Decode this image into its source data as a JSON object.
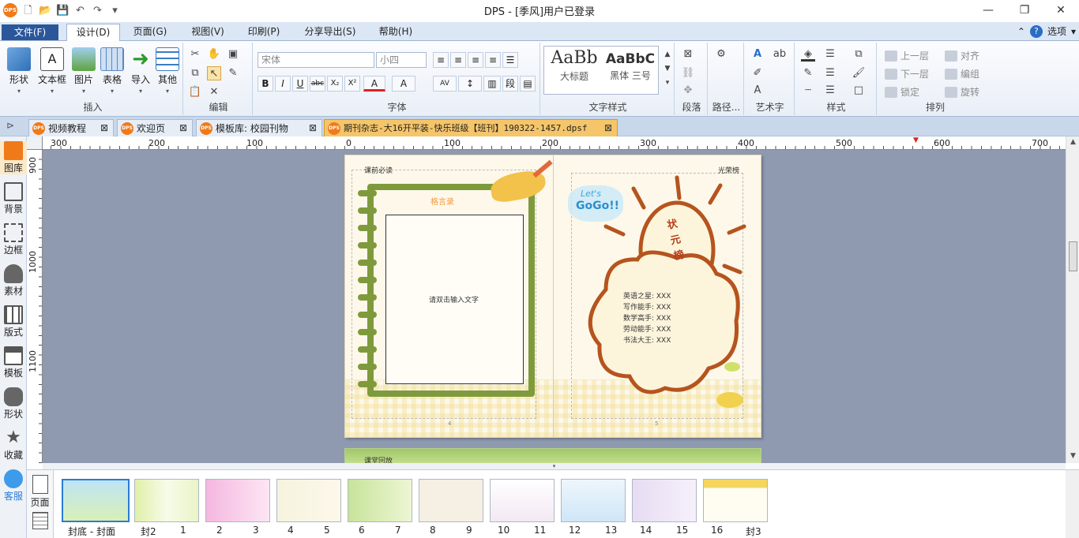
{
  "window": {
    "title": "DPS - [季风]用户已登录",
    "min": "—",
    "max": "❐",
    "close": "✕"
  },
  "menu": {
    "file": "文件(F)",
    "tabs": [
      "设计(D)",
      "页面(G)",
      "视图(V)",
      "印刷(P)",
      "分享导出(S)",
      "帮助(H)"
    ],
    "options": "选项",
    "help_icon": "?"
  },
  "ribbon": {
    "insert": {
      "label": "插入",
      "buttons": [
        "形状",
        "文本框",
        "图片",
        "表格",
        "导入",
        "其他"
      ]
    },
    "edit": {
      "label": "编辑"
    },
    "font": {
      "label": "字体",
      "family": "宋体",
      "size": "小四",
      "buttons": [
        "B",
        "I",
        "U",
        "abc",
        "X₂",
        "X²",
        "A",
        "A"
      ]
    },
    "text_style": {
      "label": "文字样式",
      "styles": [
        {
          "sample": "AaBb",
          "name": "大标题"
        },
        {
          "sample": "AaBbC",
          "name": "黑体 三号"
        }
      ]
    },
    "paragraph": {
      "label": "段落"
    },
    "path": {
      "label": "路径..."
    },
    "art": {
      "label": "艺术字"
    },
    "style": {
      "label": "样式"
    },
    "arrange": {
      "label": "排列",
      "items": [
        "上一层",
        "对齐",
        "下一层",
        "编组",
        "锁定",
        "旋转"
      ]
    }
  },
  "doc_tabs": [
    {
      "label": "视频教程",
      "active": false
    },
    {
      "label": "欢迎页",
      "active": false
    },
    {
      "label": "模板库: 校园刊物",
      "active": false
    },
    {
      "label": "期刊杂志-大16开平装-快乐班级【班刊】190322-1457.dpsf",
      "active": true
    }
  ],
  "left_panel": [
    "图库",
    "背景",
    "边框",
    "素材",
    "版式",
    "模板",
    "形状",
    "收藏",
    "客服"
  ],
  "ruler_h": [
    "300",
    "200",
    "100",
    "0",
    "100",
    "200",
    "300",
    "400",
    "500",
    "600",
    "700"
  ],
  "ruler_v": [
    "900",
    "1000",
    "1100"
  ],
  "spread": {
    "left_header": "课前必读",
    "right_header": "光荣榜",
    "motto": "格言录",
    "placeholder": "请双击输入文字",
    "lets": "Let's",
    "gogo": "GoGo!!",
    "banner": "状元榜",
    "honors": [
      "英语之星: XXX",
      "写作能手: XXX",
      "数学高手: XXX",
      "劳动能手: XXX",
      "书法大王: XXX"
    ],
    "page_num_left": "4",
    "page_num_right": "5",
    "next_header": "课堂回放"
  },
  "thumbs": {
    "side_label": "页面",
    "items": [
      {
        "label": "封底 - 封面",
        "sel": true
      },
      {
        "label": "封2",
        "label2": "1"
      },
      {
        "label": "2",
        "label2": "3"
      },
      {
        "label": "4",
        "label2": "5"
      },
      {
        "label": "6",
        "label2": "7"
      },
      {
        "label": "8",
        "label2": "9"
      },
      {
        "label": "10",
        "label2": "11"
      },
      {
        "label": "12",
        "label2": "13"
      },
      {
        "label": "14",
        "label2": "15"
      },
      {
        "label": "16",
        "label2": "封3"
      }
    ]
  },
  "colors": {
    "accent": "#2b579a",
    "tab_active": "#f5c56a",
    "canvas": "#8f9ab1",
    "spiral_green": "#7f9a3c",
    "cloud_brown": "#b5541e"
  }
}
